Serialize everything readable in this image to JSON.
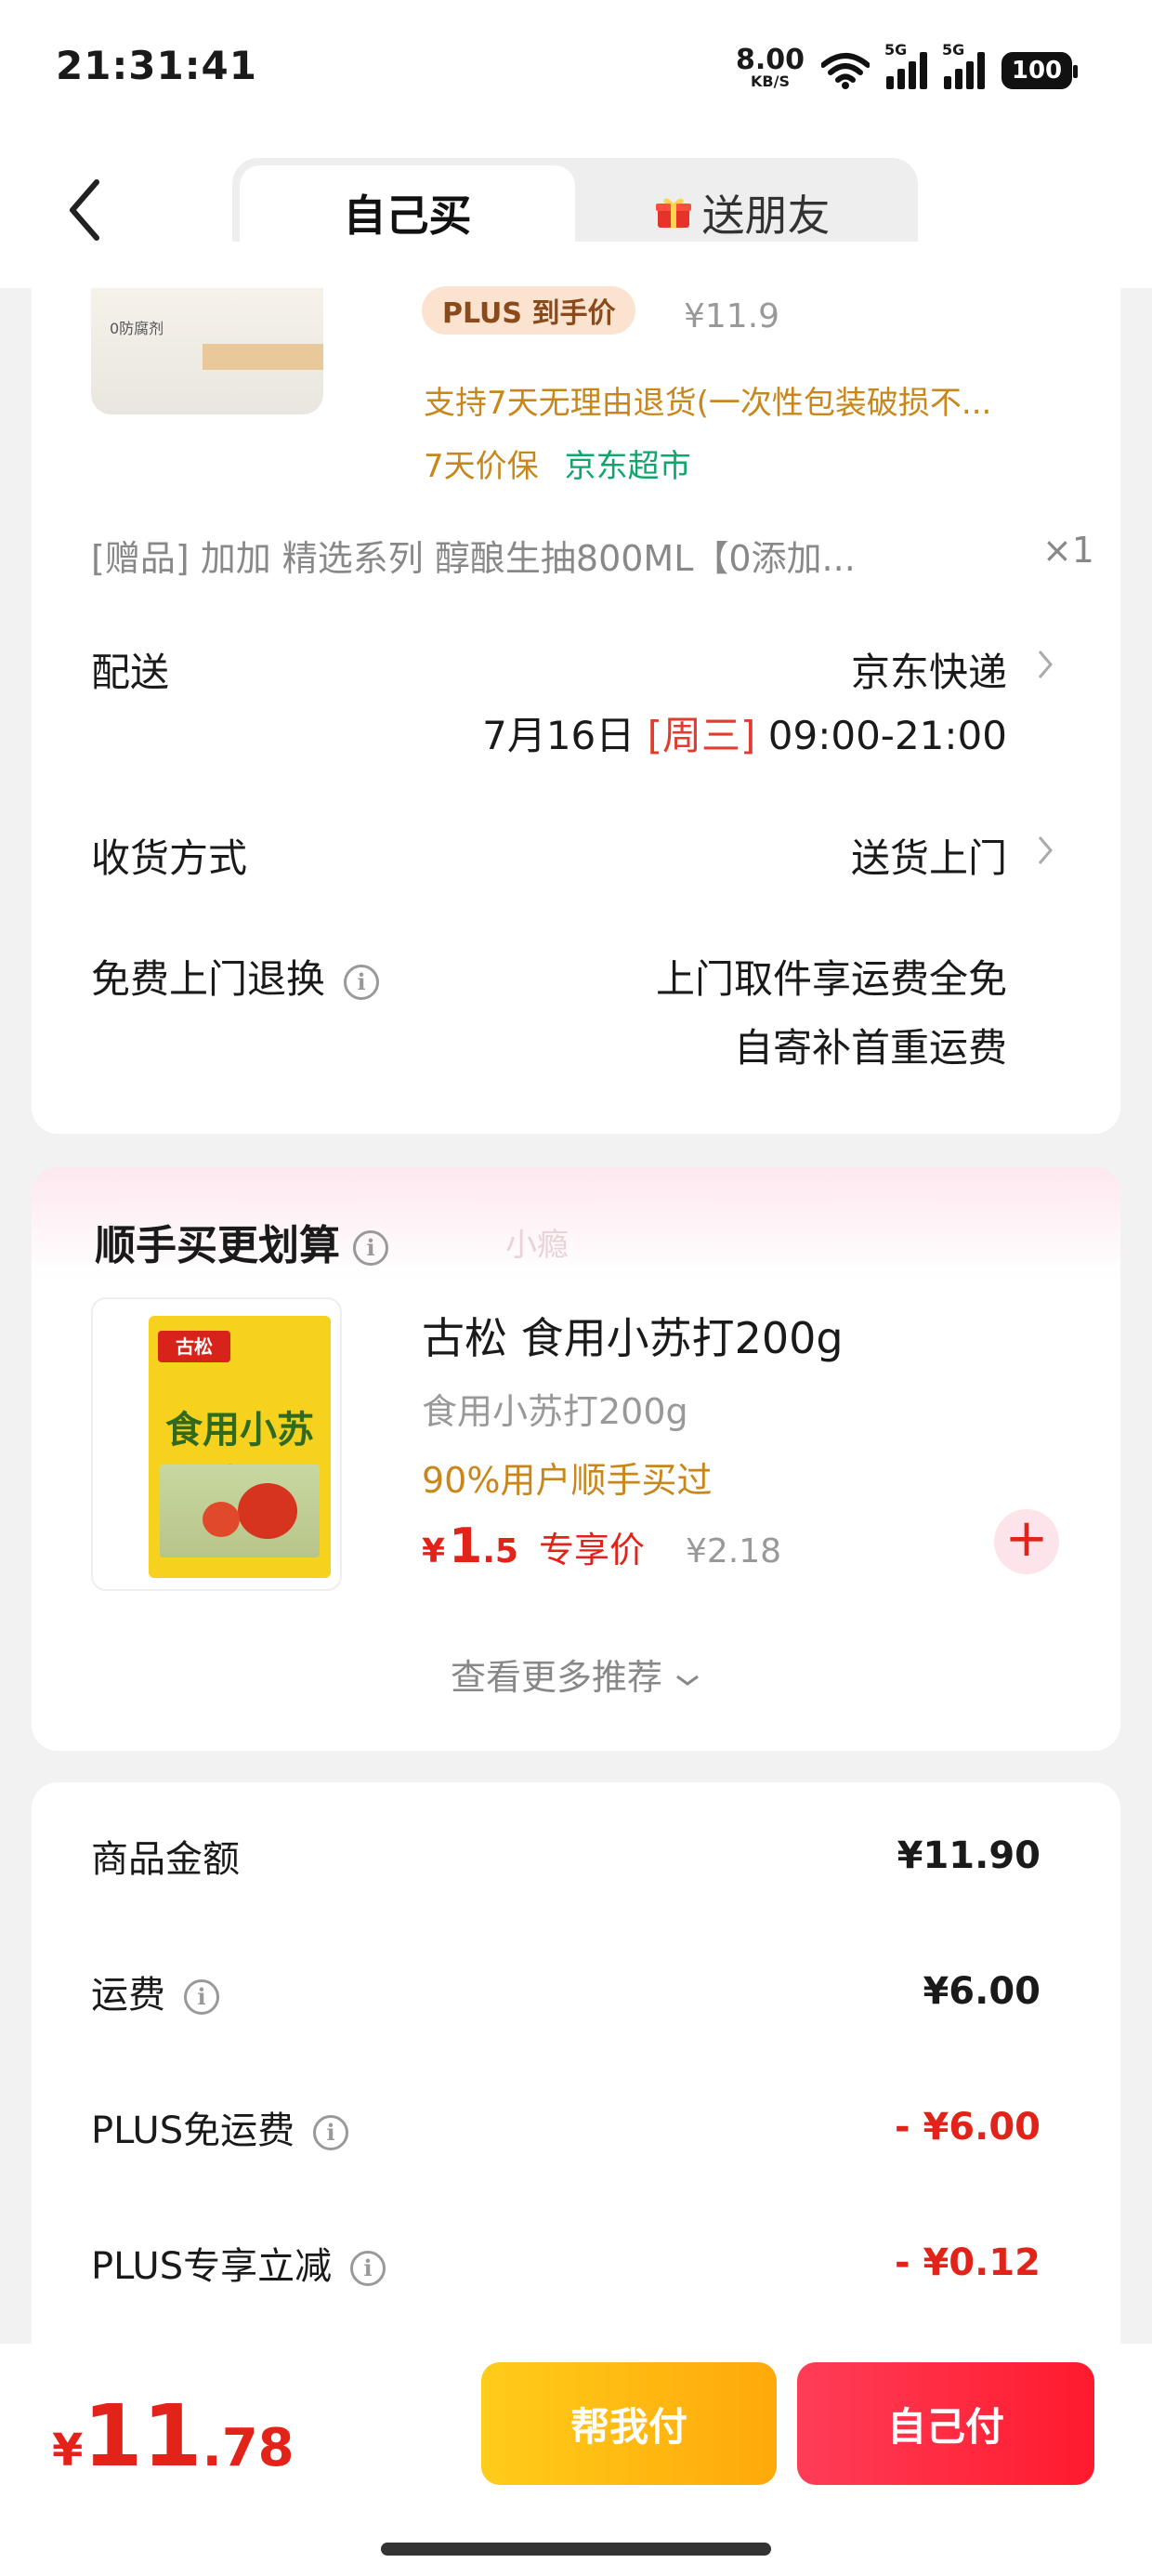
{
  "status_bar": {
    "time": "21:31:41",
    "net_speed_value": "8.00",
    "net_speed_unit": "KB/S",
    "signal1_label": "5G",
    "signal2_label": "5G",
    "battery": "100"
  },
  "header": {
    "tabs": [
      {
        "label": "自己买",
        "active": true
      },
      {
        "label": "送朋友",
        "active": false,
        "icon": "gift-icon"
      }
    ]
  },
  "product": {
    "image_label": "0防腐剂",
    "plus_badge": "PLUS 到手价",
    "plus_price": "¥11.9",
    "return_policy": "支持7天无理由退货(一次性包装破损不...",
    "price_protect": "7天价保",
    "store": "京东超市",
    "gift_text": "[赠品]  加加 精选系列 醇酿生抽800ML【0添加...",
    "gift_qty": "×1"
  },
  "delivery": {
    "label": "配送",
    "method": "京东快递",
    "date": "7月16日",
    "weekday": "[周三]",
    "time_window": "09:00-21:00"
  },
  "receive": {
    "label": "收货方式",
    "value": "送货上门"
  },
  "free_return": {
    "label": "免费上门退换",
    "line1": "上门取件享运费全免",
    "line2": "自寄补首重运费"
  },
  "recommend": {
    "title": "顺手买更划算",
    "watermark": "小瘾",
    "item": {
      "brand": "古松",
      "pack_title": "食用小苏打",
      "name": "古松 食用小苏打200g",
      "spec": "食用小苏打200g",
      "hint": "90%用户顺手买过",
      "price_yen": "¥",
      "price_int": "1",
      "price_dec": ".5",
      "price_tag": "专享价",
      "orig_price": "¥2.18"
    },
    "more": "查看更多推荐"
  },
  "summary": {
    "rows": [
      {
        "label": "商品金额",
        "value": "¥11.90",
        "info": false,
        "red": false
      },
      {
        "label": "运费",
        "value": "¥6.00",
        "info": true,
        "red": false
      },
      {
        "label": "PLUS免运费",
        "value": "- ¥6.00",
        "info": true,
        "red": true
      },
      {
        "label": "PLUS专享立减",
        "value": "- ¥0.12",
        "info": true,
        "red": true
      }
    ]
  },
  "footer": {
    "total_yen": "¥",
    "total_int": "11",
    "total_dec": ".78",
    "help_pay": "帮我付",
    "self_pay": "自己付"
  },
  "colors": {
    "accent_red": "#e2231a",
    "promo_orange": "#c8861b",
    "store_green": "#10a56b",
    "help_button": "#ffb40f",
    "pay_button": "#ff2a40"
  }
}
